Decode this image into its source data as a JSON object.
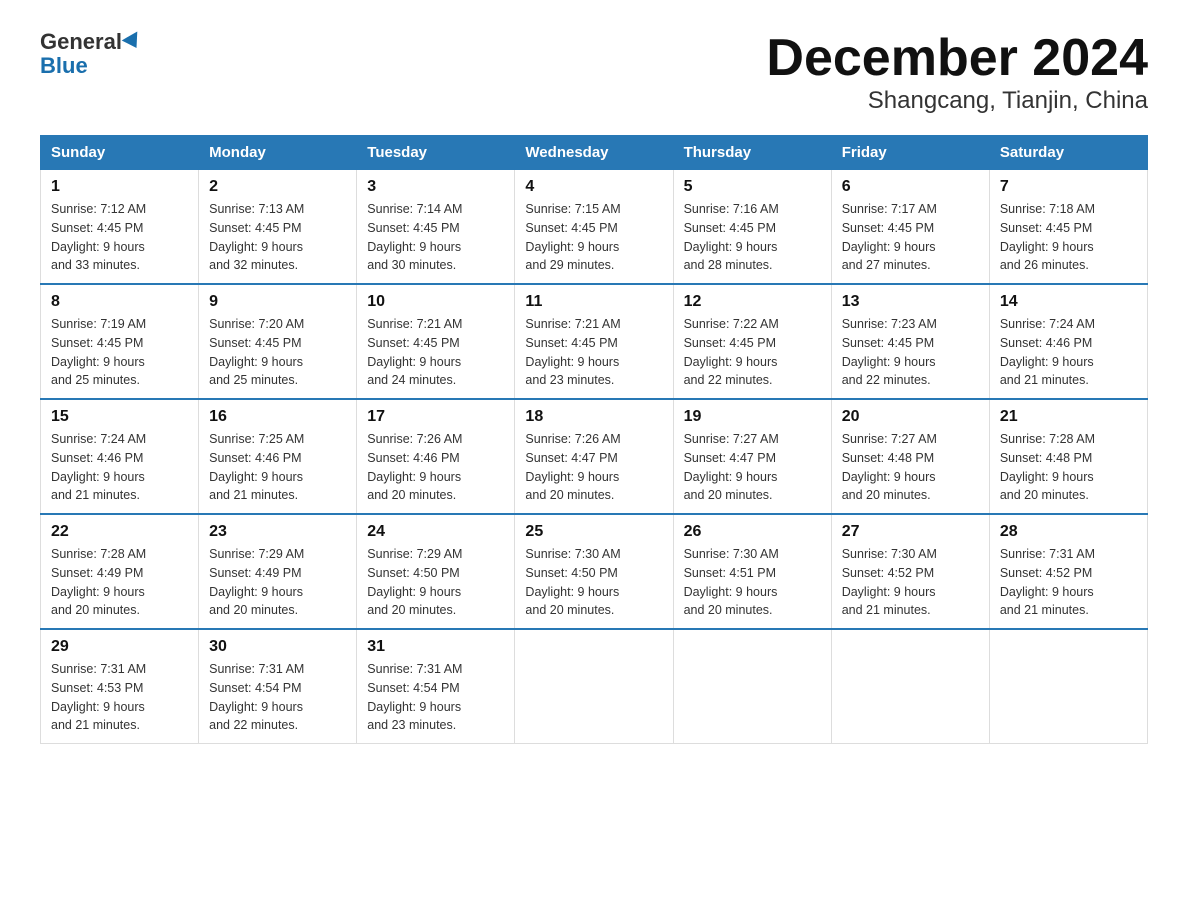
{
  "header": {
    "logo_general": "General",
    "logo_blue": "Blue",
    "title": "December 2024",
    "subtitle": "Shangcang, Tianjin, China"
  },
  "weekdays": [
    "Sunday",
    "Monday",
    "Tuesday",
    "Wednesday",
    "Thursday",
    "Friday",
    "Saturday"
  ],
  "weeks": [
    [
      {
        "day": "1",
        "sunrise": "7:12 AM",
        "sunset": "4:45 PM",
        "daylight": "9 hours and 33 minutes."
      },
      {
        "day": "2",
        "sunrise": "7:13 AM",
        "sunset": "4:45 PM",
        "daylight": "9 hours and 32 minutes."
      },
      {
        "day": "3",
        "sunrise": "7:14 AM",
        "sunset": "4:45 PM",
        "daylight": "9 hours and 30 minutes."
      },
      {
        "day": "4",
        "sunrise": "7:15 AM",
        "sunset": "4:45 PM",
        "daylight": "9 hours and 29 minutes."
      },
      {
        "day": "5",
        "sunrise": "7:16 AM",
        "sunset": "4:45 PM",
        "daylight": "9 hours and 28 minutes."
      },
      {
        "day": "6",
        "sunrise": "7:17 AM",
        "sunset": "4:45 PM",
        "daylight": "9 hours and 27 minutes."
      },
      {
        "day": "7",
        "sunrise": "7:18 AM",
        "sunset": "4:45 PM",
        "daylight": "9 hours and 26 minutes."
      }
    ],
    [
      {
        "day": "8",
        "sunrise": "7:19 AM",
        "sunset": "4:45 PM",
        "daylight": "9 hours and 25 minutes."
      },
      {
        "day": "9",
        "sunrise": "7:20 AM",
        "sunset": "4:45 PM",
        "daylight": "9 hours and 25 minutes."
      },
      {
        "day": "10",
        "sunrise": "7:21 AM",
        "sunset": "4:45 PM",
        "daylight": "9 hours and 24 minutes."
      },
      {
        "day": "11",
        "sunrise": "7:21 AM",
        "sunset": "4:45 PM",
        "daylight": "9 hours and 23 minutes."
      },
      {
        "day": "12",
        "sunrise": "7:22 AM",
        "sunset": "4:45 PM",
        "daylight": "9 hours and 22 minutes."
      },
      {
        "day": "13",
        "sunrise": "7:23 AM",
        "sunset": "4:45 PM",
        "daylight": "9 hours and 22 minutes."
      },
      {
        "day": "14",
        "sunrise": "7:24 AM",
        "sunset": "4:46 PM",
        "daylight": "9 hours and 21 minutes."
      }
    ],
    [
      {
        "day": "15",
        "sunrise": "7:24 AM",
        "sunset": "4:46 PM",
        "daylight": "9 hours and 21 minutes."
      },
      {
        "day": "16",
        "sunrise": "7:25 AM",
        "sunset": "4:46 PM",
        "daylight": "9 hours and 21 minutes."
      },
      {
        "day": "17",
        "sunrise": "7:26 AM",
        "sunset": "4:46 PM",
        "daylight": "9 hours and 20 minutes."
      },
      {
        "day": "18",
        "sunrise": "7:26 AM",
        "sunset": "4:47 PM",
        "daylight": "9 hours and 20 minutes."
      },
      {
        "day": "19",
        "sunrise": "7:27 AM",
        "sunset": "4:47 PM",
        "daylight": "9 hours and 20 minutes."
      },
      {
        "day": "20",
        "sunrise": "7:27 AM",
        "sunset": "4:48 PM",
        "daylight": "9 hours and 20 minutes."
      },
      {
        "day": "21",
        "sunrise": "7:28 AM",
        "sunset": "4:48 PM",
        "daylight": "9 hours and 20 minutes."
      }
    ],
    [
      {
        "day": "22",
        "sunrise": "7:28 AM",
        "sunset": "4:49 PM",
        "daylight": "9 hours and 20 minutes."
      },
      {
        "day": "23",
        "sunrise": "7:29 AM",
        "sunset": "4:49 PM",
        "daylight": "9 hours and 20 minutes."
      },
      {
        "day": "24",
        "sunrise": "7:29 AM",
        "sunset": "4:50 PM",
        "daylight": "9 hours and 20 minutes."
      },
      {
        "day": "25",
        "sunrise": "7:30 AM",
        "sunset": "4:50 PM",
        "daylight": "9 hours and 20 minutes."
      },
      {
        "day": "26",
        "sunrise": "7:30 AM",
        "sunset": "4:51 PM",
        "daylight": "9 hours and 20 minutes."
      },
      {
        "day": "27",
        "sunrise": "7:30 AM",
        "sunset": "4:52 PM",
        "daylight": "9 hours and 21 minutes."
      },
      {
        "day": "28",
        "sunrise": "7:31 AM",
        "sunset": "4:52 PM",
        "daylight": "9 hours and 21 minutes."
      }
    ],
    [
      {
        "day": "29",
        "sunrise": "7:31 AM",
        "sunset": "4:53 PM",
        "daylight": "9 hours and 21 minutes."
      },
      {
        "day": "30",
        "sunrise": "7:31 AM",
        "sunset": "4:54 PM",
        "daylight": "9 hours and 22 minutes."
      },
      {
        "day": "31",
        "sunrise": "7:31 AM",
        "sunset": "4:54 PM",
        "daylight": "9 hours and 23 minutes."
      },
      null,
      null,
      null,
      null
    ]
  ],
  "labels": {
    "sunrise": "Sunrise:",
    "sunset": "Sunset:",
    "daylight": "Daylight:"
  }
}
